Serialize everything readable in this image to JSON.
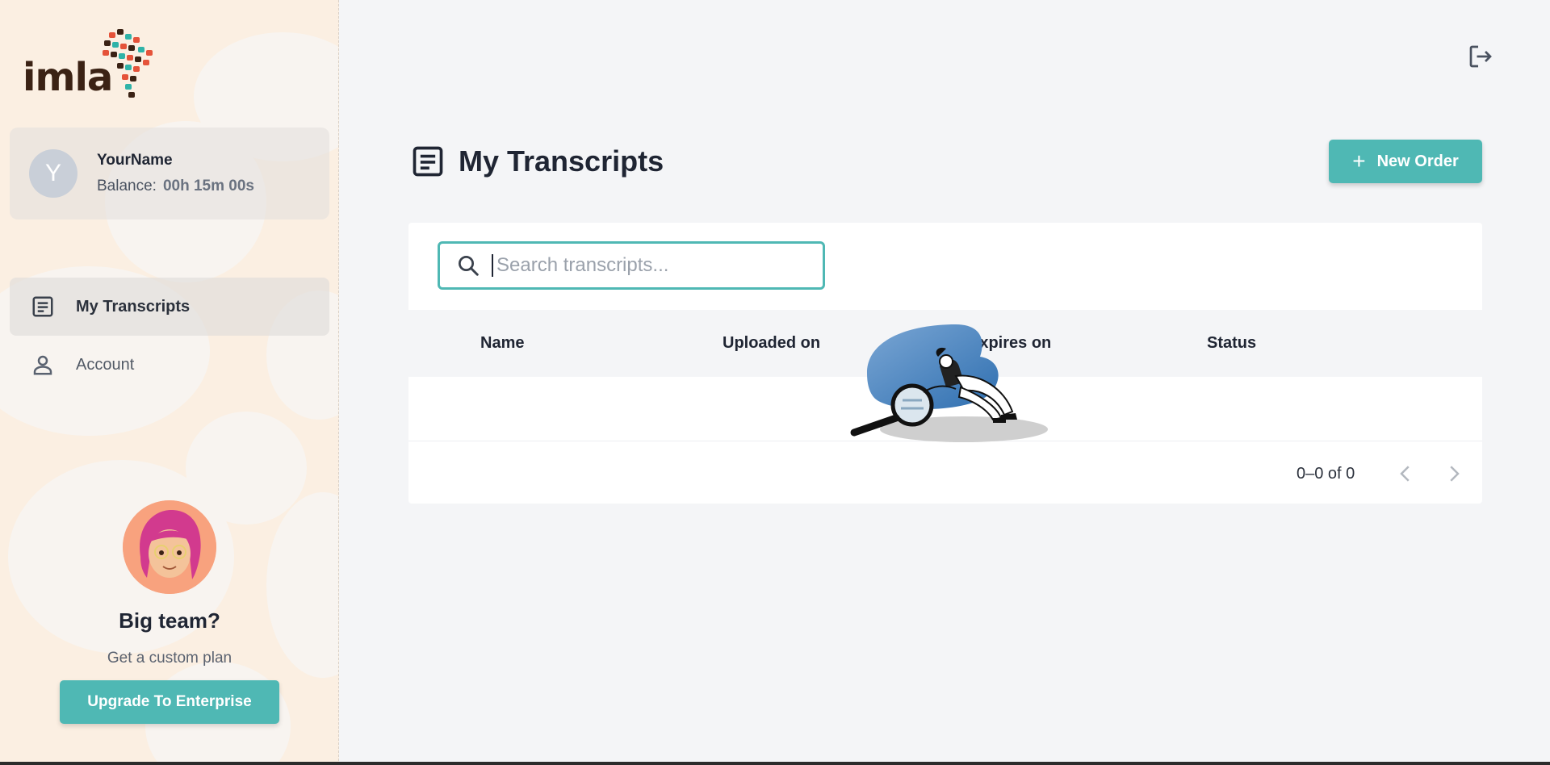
{
  "app": {
    "logo_text": "imla"
  },
  "user": {
    "avatar_initial": "Y",
    "name": "YourName",
    "balance_label": "Balance:",
    "balance_value": "00h 15m 00s"
  },
  "sidebar": {
    "items": [
      {
        "label": "My Transcripts",
        "icon": "document-icon",
        "active": true
      },
      {
        "label": "Account",
        "icon": "person-icon",
        "active": false
      }
    ]
  },
  "promo": {
    "title": "Big team?",
    "subtitle": "Get a custom plan",
    "button_label": "Upgrade To Enterprise"
  },
  "header": {
    "title": "My Transcripts",
    "new_order_label": "New Order",
    "logout_icon": "logout-icon"
  },
  "search": {
    "placeholder": "Search transcripts...",
    "value": ""
  },
  "table": {
    "columns": [
      "Name",
      "Uploaded on",
      "Expires on",
      "Status"
    ],
    "rows": []
  },
  "pagination": {
    "range_text": "0–0 of 0"
  },
  "colors": {
    "accent": "#4fb8b4",
    "sidebar_bg": "#fbefe2",
    "page_bg": "#f4f5f7"
  }
}
